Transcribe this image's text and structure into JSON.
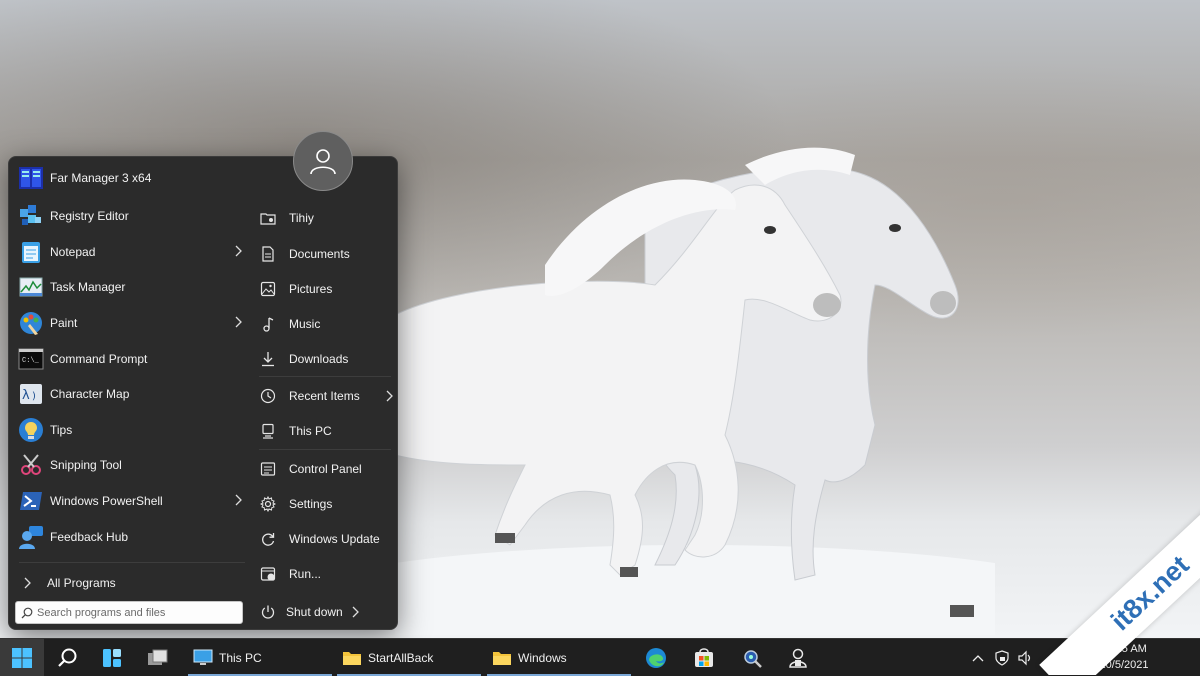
{
  "start_menu": {
    "apps": [
      {
        "label": "Far Manager 3 x64",
        "icon": "far-manager-icon",
        "has_submenu": false
      },
      {
        "label": "Registry Editor",
        "icon": "registry-editor-icon",
        "has_submenu": false
      },
      {
        "label": "Notepad",
        "icon": "notepad-icon",
        "has_submenu": true
      },
      {
        "label": "Task Manager",
        "icon": "task-manager-icon",
        "has_submenu": false
      },
      {
        "label": "Paint",
        "icon": "paint-icon",
        "has_submenu": true
      },
      {
        "label": "Command Prompt",
        "icon": "command-prompt-icon",
        "has_submenu": false
      },
      {
        "label": "Character Map",
        "icon": "character-map-icon",
        "has_submenu": false
      },
      {
        "label": "Tips",
        "icon": "tips-icon",
        "has_submenu": false
      },
      {
        "label": "Snipping Tool",
        "icon": "snipping-tool-icon",
        "has_submenu": false
      },
      {
        "label": "Windows PowerShell",
        "icon": "powershell-icon",
        "has_submenu": true
      },
      {
        "label": "Feedback Hub",
        "icon": "feedback-hub-icon",
        "has_submenu": false
      }
    ],
    "all_programs_label": "All Programs",
    "search_placeholder": "Search programs and files",
    "places": [
      {
        "label": "Tihiy",
        "icon": "user-folder-icon"
      },
      {
        "label": "Documents",
        "icon": "document-icon"
      },
      {
        "label": "Pictures",
        "icon": "picture-icon"
      },
      {
        "label": "Music",
        "icon": "music-note-icon"
      },
      {
        "label": "Downloads",
        "icon": "download-icon"
      },
      {
        "label": "Recent Items",
        "icon": "clock-icon",
        "has_submenu": true
      },
      {
        "label": "This PC",
        "icon": "computer-icon"
      },
      {
        "label": "Control Panel",
        "icon": "control-panel-icon"
      },
      {
        "label": "Settings",
        "icon": "gear-icon"
      },
      {
        "label": "Windows Update",
        "icon": "refresh-icon"
      },
      {
        "label": "Run...",
        "icon": "run-icon"
      }
    ],
    "shutdown_label": "Shut down"
  },
  "taskbar": {
    "windows": [
      {
        "label": "This PC",
        "icon": "computer-icon"
      },
      {
        "label": "StartAllBack",
        "icon": "folder-icon"
      },
      {
        "label": "Windows",
        "icon": "folder-icon"
      }
    ],
    "pinned": [
      "edge-icon",
      "store-icon",
      "magnifier-app-icon",
      "security-app-icon"
    ],
    "tray_lang": "G",
    "clock_time": "11:15 AM",
    "clock_date": "10/5/2021"
  },
  "watermark": "it8x.net",
  "colors": {
    "menu_bg": "#2b2b2b",
    "taskbar_bg": "#1f1f1f",
    "accent": "#4cc2ff",
    "watermark_blue": "#2e6fb6"
  }
}
